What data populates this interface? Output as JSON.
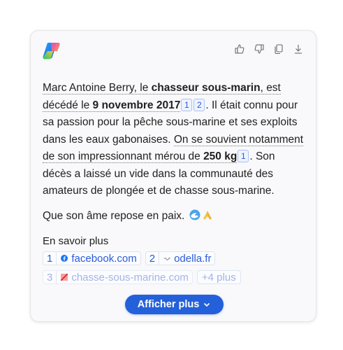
{
  "message": {
    "p1": {
      "t1": "Marc Antoine Berry, le ",
      "b1": "chasseur sous-marin",
      "t2": ", est décédé le ",
      "b2": "9 novembre 2017",
      "t3": ". Il était connu pour sa passion pour la pêche sous-marine et ses exploits dans les eaux gabonaises. ",
      "t4": "On se souvient notamment de son impressionnant mérou de ",
      "b3": "250 kg",
      "t5": ". Son décès a laissé un vide dans la communauté des amateurs de plongée et de chasse sous-marine."
    },
    "p2": "Que son âme repose en paix.",
    "citations": [
      "1",
      "2",
      "1"
    ]
  },
  "actions": {
    "like_icon": "thumbs-up-icon",
    "dislike_icon": "thumbs-down-icon",
    "copy_icon": "copy-icon",
    "download_icon": "download-icon"
  },
  "learn_more": {
    "label": "En savoir plus",
    "sources": [
      {
        "num": "1",
        "label": "facebook.com",
        "icon": "facebook-icon"
      },
      {
        "num": "2",
        "label": "odella.fr",
        "icon": "odella-icon"
      },
      {
        "num": "3",
        "label": "chasse-sous-marine.com",
        "icon": "chasse-icon"
      }
    ],
    "more": "+4 plus"
  },
  "show_more": {
    "label": "Afficher plus"
  },
  "colors": {
    "accent": "#2460d9",
    "link": "#2a5bd7"
  }
}
